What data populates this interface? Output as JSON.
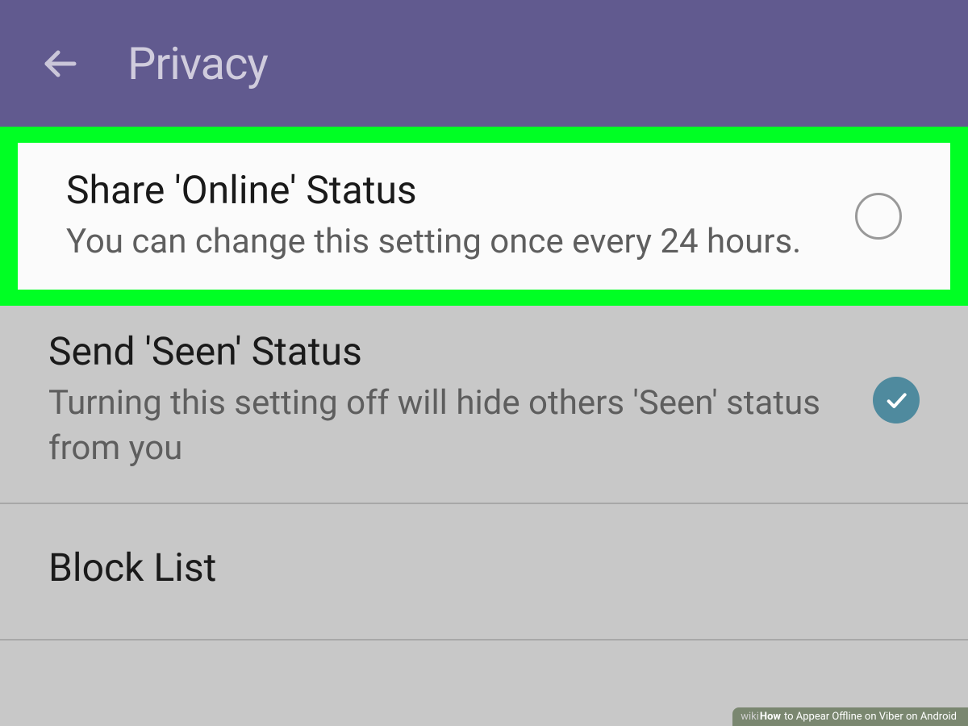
{
  "header": {
    "title": "Privacy"
  },
  "settings": {
    "shareOnline": {
      "title": "Share 'Online' Status",
      "description": "You can change this setting once every 24 hours."
    },
    "sendSeen": {
      "title": "Send 'Seen' Status",
      "description": "Turning this setting off will hide others 'Seen' status from you"
    },
    "blockList": {
      "title": "Block List"
    }
  },
  "watermark": {
    "prefix": "wiki",
    "how": "How",
    "text": " to Appear Offline on Viber on Android"
  }
}
